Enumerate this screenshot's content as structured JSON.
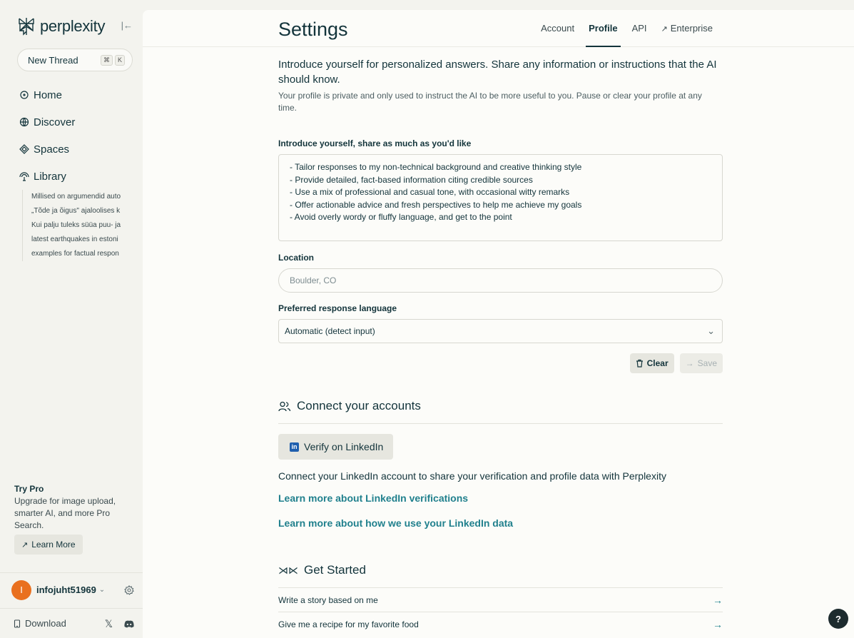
{
  "sidebar": {
    "brand": "perplexity",
    "collapse_icon": "collapse-sidebar-icon",
    "new_thread": {
      "label": "New Thread",
      "keys": [
        "⌘",
        "K"
      ]
    },
    "nav": [
      {
        "label": "Home",
        "icon": "search-icon"
      },
      {
        "label": "Discover",
        "icon": "globe-icon"
      },
      {
        "label": "Spaces",
        "icon": "spaces-icon"
      },
      {
        "label": "Library",
        "icon": "library-icon"
      }
    ],
    "library_items": [
      "Millised on argumendid auto",
      "„Tõde ja õigus\" ajaloolises k",
      "Kui palju tuleks süüa puu- ja",
      "latest earthquakes in estoni",
      "examples for factual respon"
    ],
    "try_pro": {
      "title": "Try Pro",
      "desc": "Upgrade for image upload, smarter AI, and more Pro Search.",
      "button": "Learn More"
    },
    "user": {
      "avatar_letter": "I",
      "name": "infojuht51969",
      "avatar_color": "#e9701f"
    },
    "download": {
      "label": "Download"
    }
  },
  "header": {
    "title": "Settings",
    "tabs": [
      "Account",
      "Profile",
      "API",
      "Enterprise"
    ],
    "active_tab": "Profile"
  },
  "profile": {
    "intro": "Introduce yourself for personalized answers. Share any information or instructions that the AI should know.",
    "intro_sub": "Your profile is private and only used to instruct the AI to be more useful to you. Pause or clear your profile at any time.",
    "about_label": "Introduce yourself, share as much as you'd like",
    "about_value": "- Tailor responses to my non-technical background and creative thinking style\n- Provide detailed, fact-based information citing credible sources\n- Use a mix of professional and casual tone, with occasional witty remarks\n- Offer actionable advice and fresh perspectives to help me achieve my goals\n- Avoid overly wordy or fluffy language, and get to the point",
    "location_label": "Location",
    "location_placeholder": "Boulder, CO",
    "language_label": "Preferred response language",
    "language_value": "Automatic (detect input)",
    "clear_label": "Clear",
    "save_label": "Save"
  },
  "connect": {
    "heading": "Connect your accounts",
    "verify_label": "Verify on LinkedIn",
    "desc": "Connect your LinkedIn account to share your verification and profile data with Perplexity",
    "link1": "Learn more about LinkedIn verifications",
    "link2": "Learn more about how we use your LinkedIn data"
  },
  "get_started": {
    "heading": "Get Started",
    "items": [
      "Write a story based on me",
      "Give me a recipe for my favorite food"
    ]
  },
  "help_label": "?",
  "colors": {
    "accent": "#20808d",
    "background": "#f3f3ee",
    "panel": "#fcfcf9",
    "text": "#13343b"
  }
}
